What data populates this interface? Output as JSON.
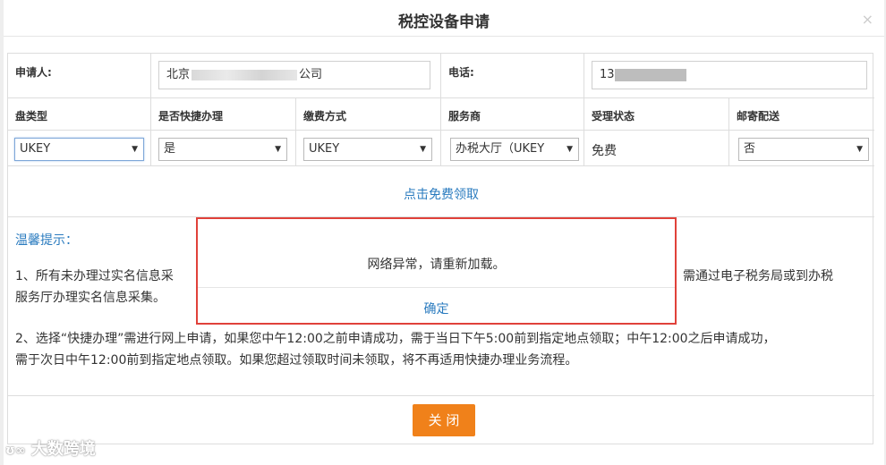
{
  "dialog": {
    "title": "税控设备申请",
    "close_glyph": "×"
  },
  "applicant": {
    "label": "申请人:",
    "value_start": "北京",
    "value_end": "公司"
  },
  "phone": {
    "label": "电话:",
    "value_prefix": "13"
  },
  "columns": {
    "disk_type": "盘类型",
    "express": "是否快捷办理",
    "payment": "缴费方式",
    "provider": "服务商",
    "status": "受理状态",
    "mail": "邮寄配送"
  },
  "values": {
    "disk_type": "UKEY",
    "express": "是",
    "payment": "UKEY",
    "provider": "办税大厅（UKEY",
    "status": "免费",
    "mail": "否"
  },
  "free_link": "点击免费领取",
  "tips": {
    "title": "温馨提示：",
    "p1_left": "1、所有未办理过实名信息采",
    "p1_right": "需通过电子税务局或到办税",
    "p1_line2": "服务厅办理实名信息采集。",
    "p2_line1": "2、选择“快捷办理”需进行网上申请，如果您中午12:00之前申请成功，需于当日下午5:00前到指定地点领取；中午12:00之后申请成功，",
    "p2_line2": "需于次日中午12:00前到指定地点领取。如果您超过领取时间未领取，将不再适用快捷办理业务流程。"
  },
  "alert": {
    "message": "网络异常，请重新加载。",
    "ok": "确定"
  },
  "footer": {
    "close_button": "关 闭"
  },
  "watermark": "大数跨境",
  "colors": {
    "accent": "#2a7bbf",
    "button": "#f0811a",
    "alert_border": "#e0413a"
  }
}
